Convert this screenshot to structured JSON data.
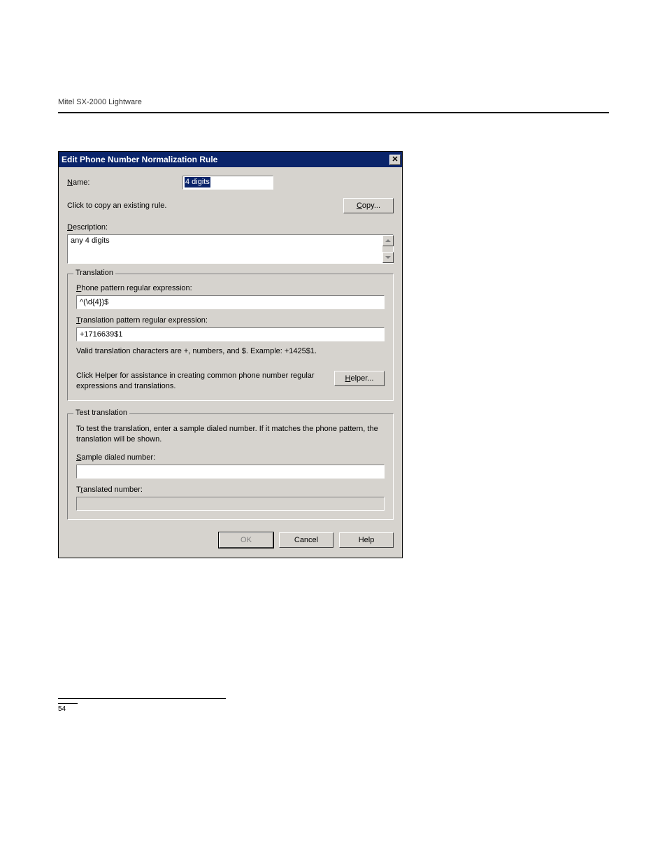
{
  "doc": {
    "header": "Mitel SX-2000 Lightware",
    "page_number": "54"
  },
  "dialog": {
    "title": "Edit Phone Number Normalization Rule",
    "name": {
      "label_prefix": "N",
      "label_rest": "ame:",
      "value": "4 digits"
    },
    "copy": {
      "hint": "Click to copy an existing rule.",
      "btn_prefix": "C",
      "btn_rest": "opy..."
    },
    "description": {
      "label_prefix": "D",
      "label_rest": "escription:",
      "value": "any 4 digits"
    },
    "translation": {
      "legend": "Translation",
      "phone_label_prefix": "P",
      "phone_label_rest": "hone pattern regular expression:",
      "phone_value": "^(\\d{4})$",
      "trans_label_prefix": "T",
      "trans_label_rest": "ranslation pattern regular expression:",
      "trans_value": "+1716639$1",
      "valid_hint": "Valid translation characters are +, numbers, and $. Example: +1425$1.",
      "helper_text": "Click Helper for assistance in creating common phone number regular expressions and translations.",
      "helper_btn_prefix": "H",
      "helper_btn_rest": "elper..."
    },
    "test": {
      "legend": "Test translation",
      "intro": "To test the translation, enter a sample dialed number. If it matches the phone pattern, the translation will be shown.",
      "sample_label_prefix": "S",
      "sample_label_rest": "ample dialed number:",
      "sample_value": "",
      "translated_label_pre": "T",
      "translated_label_mid": "r",
      "translated_label_post": "anslated number:",
      "translated_value": ""
    },
    "buttons": {
      "ok": "OK",
      "cancel": "Cancel",
      "help": "Help"
    }
  }
}
